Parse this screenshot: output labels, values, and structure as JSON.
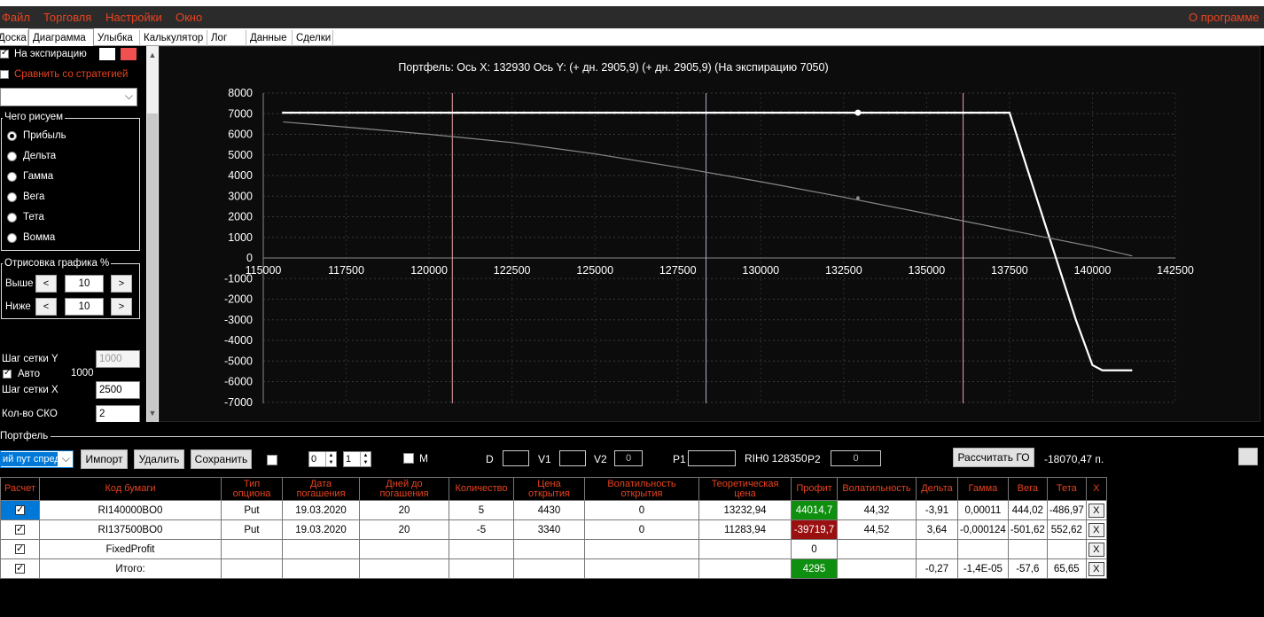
{
  "window": {
    "title": ""
  },
  "menu": {
    "file": "Файл",
    "trade": "Торговля",
    "settings": "Настройки",
    "window": "Окно",
    "about": "О программе"
  },
  "tabs": [
    "Доска",
    "Диаграмма",
    "Улыбка",
    "Калькулятор",
    "Лог",
    "Данные",
    "Сделки"
  ],
  "left": {
    "at_expiry": "На экспирацию",
    "compare": "Сравнить со стратегией",
    "what_draw_title": "Чего рисуем",
    "radios": [
      "Прибыль",
      "Дельта",
      "Гамма",
      "Вега",
      "Тета",
      "Вомма"
    ],
    "draw_title": "Отрисовка графика %",
    "above": "Выше",
    "above_val": "10",
    "below": "Ниже",
    "below_val": "10",
    "prev_arrow": "<",
    "next_arrow": ">",
    "grid_y": "Шаг сетки Y",
    "grid_y_val": "1000",
    "auto": "Авто",
    "auto_val": "1000",
    "grid_x": "Шаг сетки X",
    "grid_x_val": "2500",
    "sko": "Кол-во СКО",
    "sko_val": "2"
  },
  "chart_data": {
    "type": "line",
    "title": "Портфель: Ось X: 132930 Ось Y:  (+ дн. 2905,9)  (+ дн. 2905,9)  (На экспирацию 7050)",
    "xlim": [
      115000,
      142500
    ],
    "ylim": [
      -7000,
      8000
    ],
    "xticks": [
      115000,
      117500,
      120000,
      122500,
      125000,
      127500,
      130000,
      132500,
      135000,
      137500,
      140000,
      142500
    ],
    "yticks": [
      8000,
      7000,
      6000,
      5000,
      4000,
      3000,
      2000,
      1000,
      0,
      -1000,
      -2000,
      -3000,
      -4000,
      -5000,
      -6000,
      -7000
    ],
    "vlines": [
      {
        "x": 120700,
        "color": "#e8a0a8"
      },
      {
        "x": 128350,
        "color": "#b0b0c8"
      },
      {
        "x": 136100,
        "color": "#e8a0a8"
      }
    ],
    "series": [
      {
        "color": "#ffffff",
        "x": [
          115600,
          137500,
          138000,
          138700,
          139500,
          140000,
          140300,
          141200
        ],
        "y": [
          7050,
          7050,
          4500,
          1000,
          -3000,
          -5200,
          -5450,
          -5450
        ]
      },
      {
        "color": "#8a8a8a",
        "x": [
          115600,
          117500,
          120000,
          122500,
          125000,
          127500,
          130000,
          132500,
          135000,
          137500,
          140000,
          141200
        ],
        "y": [
          6600,
          6350,
          6000,
          5600,
          5050,
          4400,
          3700,
          2950,
          2150,
          1350,
          550,
          100
        ]
      }
    ],
    "markers": [
      {
        "x": 132930,
        "y": 7050,
        "color": "#ffffff"
      },
      {
        "x": 132930,
        "y": 2906,
        "color": "#8a8a8a"
      }
    ]
  },
  "portfolio": {
    "title": "Портфель",
    "combo": "ий пут спред",
    "import": "Импорт",
    "delete": "Удалить",
    "save": "Сохранить",
    "spin1": "0",
    "spin2": "1",
    "m_label": "M",
    "d_label": "D",
    "v1_label": "V1",
    "v2_label": "V2",
    "v2_val": "0",
    "p1_label": "P1",
    "rih": "RIH0 128350",
    "p2_label": "P2",
    "p2_val": "0",
    "calc_go": "Рассчитать ГО",
    "go_val": "-18070,47 п."
  },
  "table": {
    "headers": [
      "Расчет",
      "Код бумаги",
      "Тип опциона",
      "Дата погашения",
      "Дней до погашения",
      "Количество",
      "Цена открытия",
      "Волатильность открытия",
      "Теоретическая цена",
      "Профит",
      "Волатильность",
      "Дельта",
      "Гамма",
      "Вега",
      "Тета",
      "X"
    ],
    "rows": [
      [
        "",
        "RI140000BO0",
        "Put",
        "19.03.2020",
        "20",
        "5",
        "4430",
        "0",
        "13232,94",
        "44014,7",
        "44,32",
        "-3,91",
        "0,00011",
        "444,02",
        "-486,97",
        "X"
      ],
      [
        "",
        "RI137500BO0",
        "Put",
        "19.03.2020",
        "20",
        "-5",
        "3340",
        "0",
        "11283,94",
        "-39719,7",
        "44,52",
        "3,64",
        "-0,000124",
        "-501,62",
        "552,62",
        "X"
      ],
      [
        "",
        "FixedProfit",
        "",
        "",
        "",
        "",
        "",
        "",
        "",
        "0",
        "",
        "",
        "",
        "",
        "",
        "X"
      ],
      [
        "",
        "Итого:",
        "",
        "",
        "",
        "",
        "",
        "",
        "",
        "4295",
        "",
        "-0,27",
        "-1,4E-05",
        "-57,6",
        "65,65",
        "X"
      ]
    ]
  }
}
